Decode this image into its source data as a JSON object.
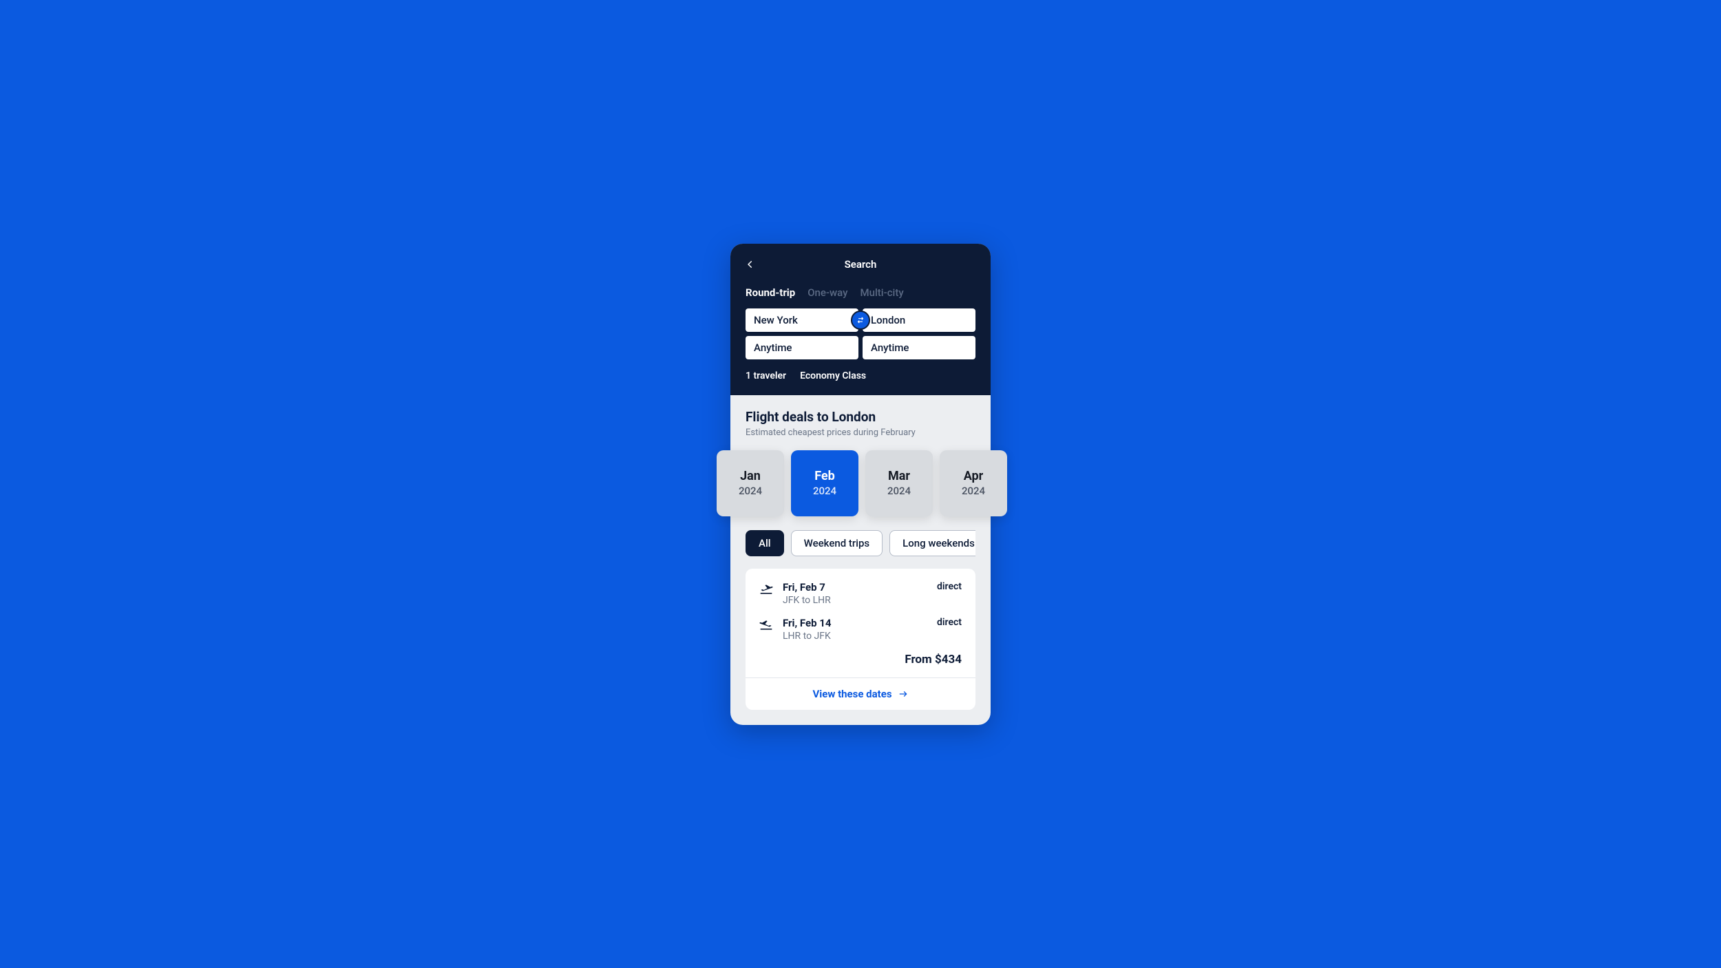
{
  "header": {
    "title": "Search",
    "tabs": [
      "Round-trip",
      "One-way",
      "Multi-city"
    ],
    "active_tab_index": 0,
    "origin": "New York",
    "destination": "London",
    "depart_date": "Anytime",
    "return_date": "Anytime",
    "travelers": "1 traveler",
    "cabin": "Economy Class"
  },
  "deals": {
    "title": "Flight deals to London",
    "subtitle": "Estimated cheapest prices during February"
  },
  "months": [
    {
      "name": "Jan",
      "year": "2024",
      "active": false
    },
    {
      "name": "Feb",
      "year": "2024",
      "active": true
    },
    {
      "name": "Mar",
      "year": "2024",
      "active": false
    },
    {
      "name": "Apr",
      "year": "2024",
      "active": false
    }
  ],
  "filters": {
    "items": [
      "All",
      "Weekend trips",
      "Long weekends"
    ],
    "active_index": 0
  },
  "deal_card": {
    "outbound": {
      "date": "Fri, Feb 7",
      "route": "JFK to LHR",
      "type": "direct"
    },
    "inbound": {
      "date": "Fri, Feb 14",
      "route": "LHR to JFK",
      "type": "direct"
    },
    "price_label": "From $434",
    "cta": "View these dates"
  },
  "colors": {
    "brand": "#0b5ae0",
    "dark": "#0d1b36"
  }
}
